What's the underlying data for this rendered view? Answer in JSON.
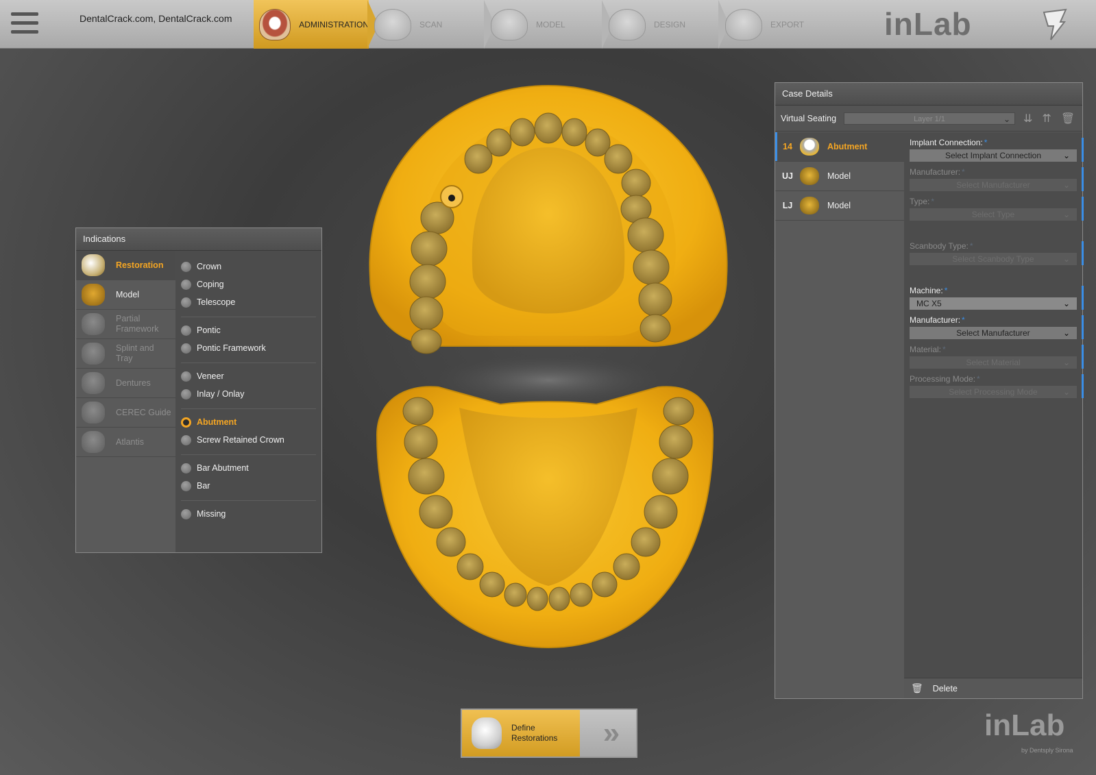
{
  "header": {
    "case_title": "DentalCrack.com, DentalCrack.com",
    "steps": [
      {
        "label": "ADMINISTRATION",
        "active": true
      },
      {
        "label": "SCAN",
        "active": false
      },
      {
        "label": "MODEL",
        "active": false
      },
      {
        "label": "DESIGN",
        "active": false
      },
      {
        "label": "EXPORT",
        "active": false
      }
    ],
    "brand": "inLab",
    "menu_icon": "hamburger-icon",
    "bolt_icon": "lightning-icon"
  },
  "indications": {
    "title": "Indications",
    "categories": [
      {
        "label": "Restoration",
        "state": "active"
      },
      {
        "label": "Model",
        "state": "enabled"
      },
      {
        "label": "Partial Framework",
        "state": "disabled"
      },
      {
        "label": "Splint and Tray",
        "state": "disabled"
      },
      {
        "label": "Dentures",
        "state": "disabled"
      },
      {
        "label": "CEREC Guide",
        "state": "disabled"
      },
      {
        "label": "Atlantis",
        "state": "disabled"
      }
    ],
    "options": {
      "crown": "Crown",
      "coping": "Coping",
      "telescope": "Telescope",
      "pontic": "Pontic",
      "pontic_framework": "Pontic Framework",
      "veneer": "Veneer",
      "inlay_onlay": "Inlay / Onlay",
      "abutment": "Abutment",
      "screw_retained_crown": "Screw Retained Crown",
      "bar_abutment": "Bar Abutment",
      "bar": "Bar",
      "missing": "Missing"
    },
    "selected_option": "Abutment"
  },
  "case_details": {
    "title": "Case Details",
    "virtual_seating_label": "Virtual Seating",
    "layer_value": "Layer 1/1",
    "items": [
      {
        "tooth": "14",
        "label": "Abutment",
        "active": true
      },
      {
        "tooth": "UJ",
        "label": "Model",
        "active": false
      },
      {
        "tooth": "LJ",
        "label": "Model",
        "active": false
      }
    ],
    "fields": {
      "implant_connection": {
        "label": "Implant Connection:",
        "value": "Select Implant Connection"
      },
      "manufacturer_1": {
        "label": "Manufacturer:",
        "value": "Select Manufacturer"
      },
      "type": {
        "label": "Type:",
        "value": "Select Type"
      },
      "scanbody_type": {
        "label": "Scanbody Type:",
        "value": "Select Scanbody Type"
      },
      "machine": {
        "label": "Machine:",
        "value": "MC X5"
      },
      "manufacturer_2": {
        "label": "Manufacturer:",
        "value": "Select Manufacturer"
      },
      "material": {
        "label": "Material:",
        "value": "Select Material"
      },
      "processing_mode": {
        "label": "Processing Mode:",
        "value": "Select Processing Mode"
      }
    },
    "required_marker": "*",
    "delete_label": "Delete"
  },
  "bottom_action": {
    "define_label": "Define Restorations",
    "next_glyph": "»"
  },
  "footer": {
    "brand": "inLab",
    "sub": "by Dentsply Sirona"
  },
  "colors": {
    "accent": "#f5a623",
    "model_yellow": "#f2b01e",
    "required_blue": "#3a8ee6"
  }
}
